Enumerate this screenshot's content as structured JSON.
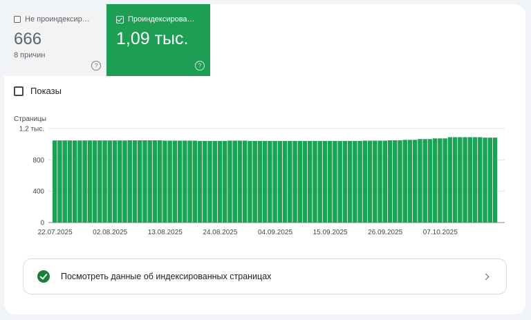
{
  "tiles": {
    "not_indexed": {
      "label": "Не проиндексир…",
      "value": "666",
      "sub": "8 причин",
      "checked": false
    },
    "indexed": {
      "label": "Проиндексирова…",
      "value": "1,09 тыс.",
      "checked": true
    }
  },
  "help_icon": "?",
  "impressions": {
    "label": "Показы",
    "checked": false
  },
  "link_card": {
    "text": "Посмотреть данные об индексированных страницах",
    "icon": "check-circle-icon",
    "chevron": "chevron-right-icon"
  },
  "colors": {
    "accent": "#1e9e55",
    "bar": "#18a355"
  },
  "chart_data": {
    "type": "bar",
    "ylabel": "Страницы",
    "ylim": [
      0,
      1200
    ],
    "yticks": [
      0,
      400,
      800,
      1200
    ],
    "ytick_labels": [
      "0",
      "400",
      "800",
      "1,2 тыс."
    ],
    "xtick_labels": [
      "22.07.2025",
      "02.08.2025",
      "13.08.2025",
      "24.08.2025",
      "04.09.2025",
      "15.09.2025",
      "26.09.2025",
      "07.10.2025"
    ],
    "grid": true,
    "series": [
      {
        "values": [
          1048,
          1048,
          1048,
          1048,
          1048,
          1048,
          1048,
          1048,
          1048,
          1048,
          1048,
          1048,
          1048,
          1048,
          1048,
          1050,
          1050,
          1050,
          1050,
          1050,
          1050,
          1050,
          1046,
          1046,
          1046,
          1046,
          1046,
          1046,
          1046,
          1042,
          1042,
          1042,
          1042,
          1042,
          1042,
          1046,
          1046,
          1046,
          1046,
          1042,
          1042,
          1042,
          1042,
          1042,
          1042,
          1042,
          1042,
          1042,
          1042,
          1042,
          1042,
          1042,
          1042,
          1042,
          1042,
          1042,
          1042,
          1042,
          1042,
          1042,
          1042,
          1042,
          1046,
          1046,
          1046,
          1046,
          1046,
          1050,
          1050,
          1050,
          1056,
          1056,
          1056,
          1066,
          1066,
          1066,
          1074,
          1074,
          1074,
          1090,
          1090,
          1090,
          1090,
          1090,
          1090,
          1090,
          1084,
          1084,
          1084
        ]
      }
    ]
  }
}
